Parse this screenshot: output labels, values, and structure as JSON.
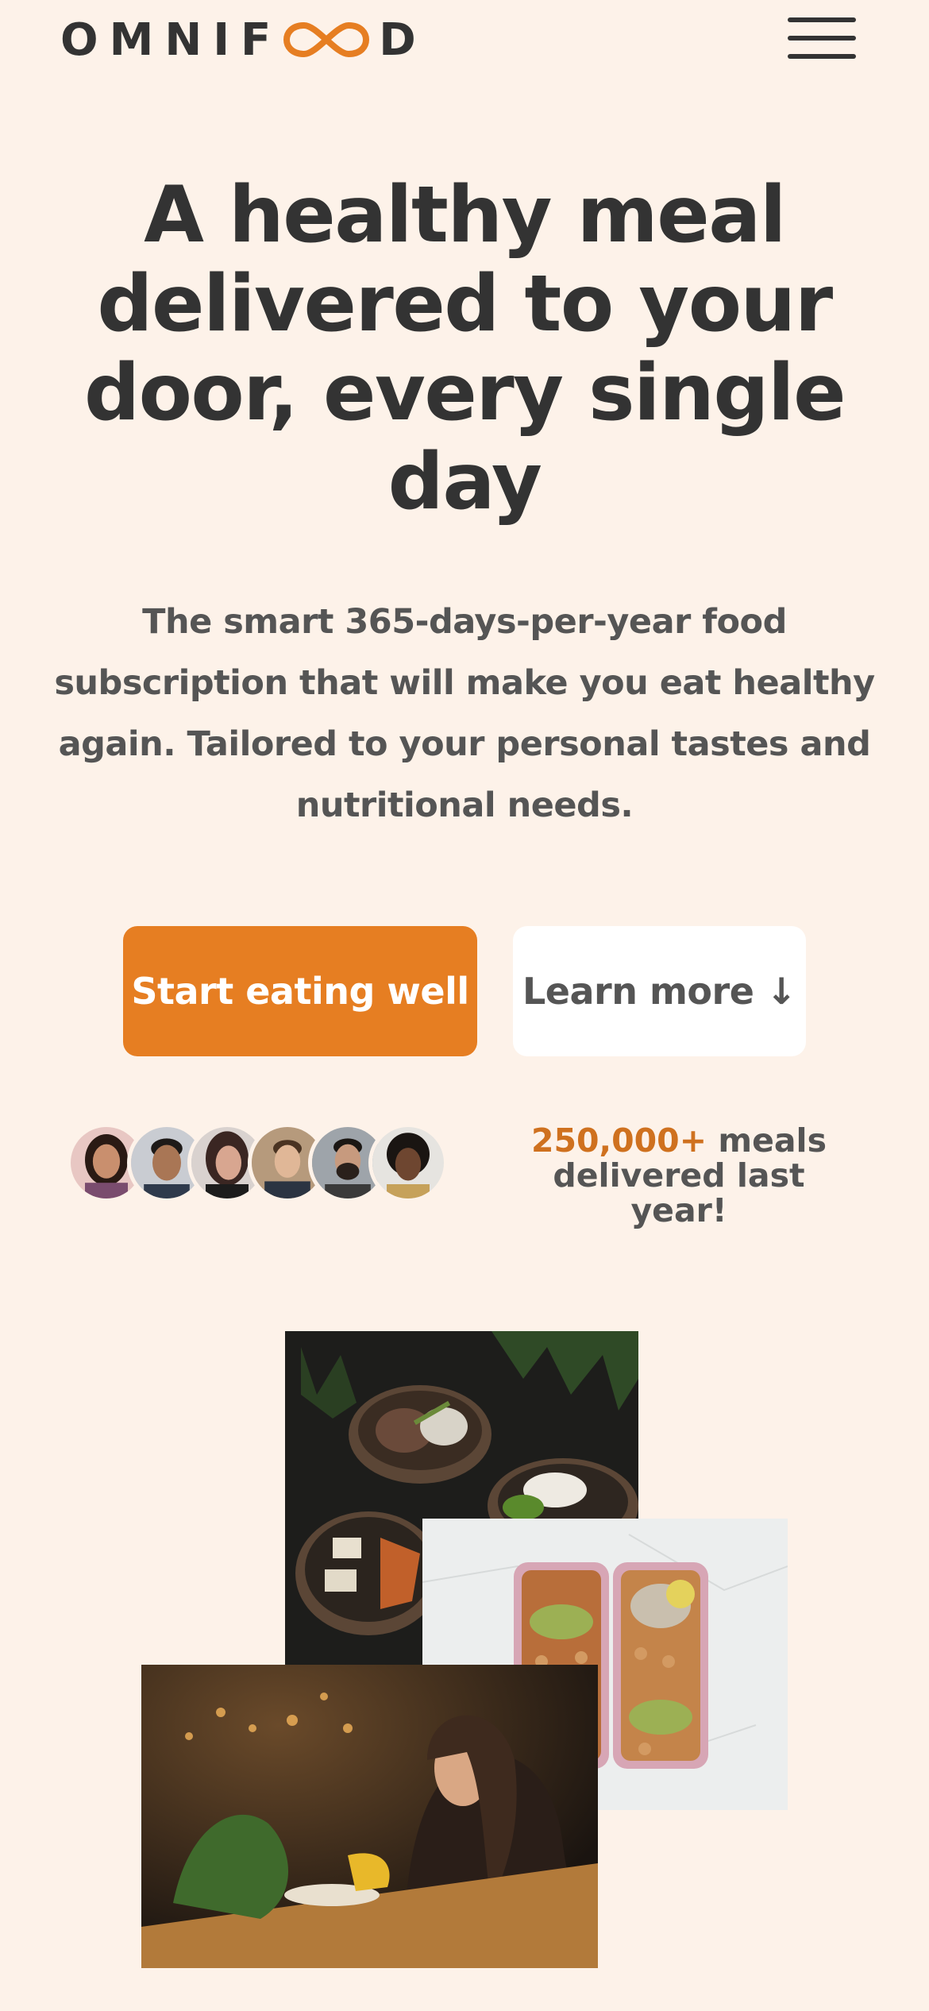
{
  "header": {
    "logo_start": "OMNIF",
    "logo_end": "D",
    "menu_icon": "hamburger-menu-icon"
  },
  "hero": {
    "title": "A healthy meal delivered to your door, every single day",
    "description": "The smart 365-days-per-year food subscription that will make you eat healthy again. Tailored to your personal tastes and nutritional needs.",
    "primary_cta": "Start eating well",
    "secondary_cta": "Learn more ↓"
  },
  "delivered": {
    "count": "250,000+",
    "text_1": " meals",
    "text_2": "delivered last year!"
  },
  "colors": {
    "background": "#fdf2e9",
    "accent": "#e67e22",
    "accent_dark": "#cf711f",
    "text": "#333333"
  }
}
